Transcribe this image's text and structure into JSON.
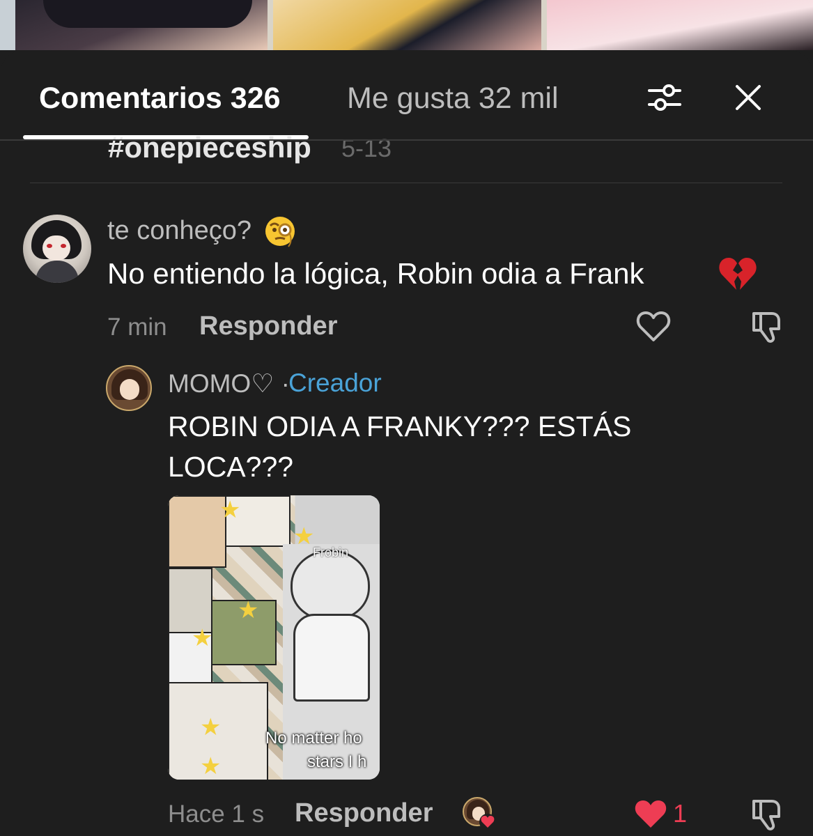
{
  "tabs": {
    "comments_label": "Comentarios 326",
    "likes_label": "Me gusta 32 mil"
  },
  "icons": {
    "filter": "sliders-icon",
    "close": "close-icon"
  },
  "clipped_caption": {
    "text": "#onepieceship",
    "date": "5-13"
  },
  "comment": {
    "username": "te conheço?",
    "emoji": "face-with-monocle",
    "text": "No entiendo la lógica, Robin odia a Frank",
    "trailing_emoji": "broken-heart",
    "time": "7 min",
    "reply_label": "Responder"
  },
  "reply": {
    "username": "MOMO♡",
    "separator": "·",
    "creator_badge": "Creador",
    "text": "ROBIN ODIA A FRANKY??? ESTÁS LOCA???",
    "attachment": {
      "label": "Frobin",
      "caption_line1": "No matter ho",
      "caption_line2": "stars I h"
    },
    "time": "Hace 1 s",
    "reply_label": "Responder",
    "like_count": "1"
  },
  "colors": {
    "background": "#1e1e1e",
    "creator_blue": "#4aa3d8",
    "like_red": "#ee3d54",
    "muted_text": "#bdbdbd"
  }
}
